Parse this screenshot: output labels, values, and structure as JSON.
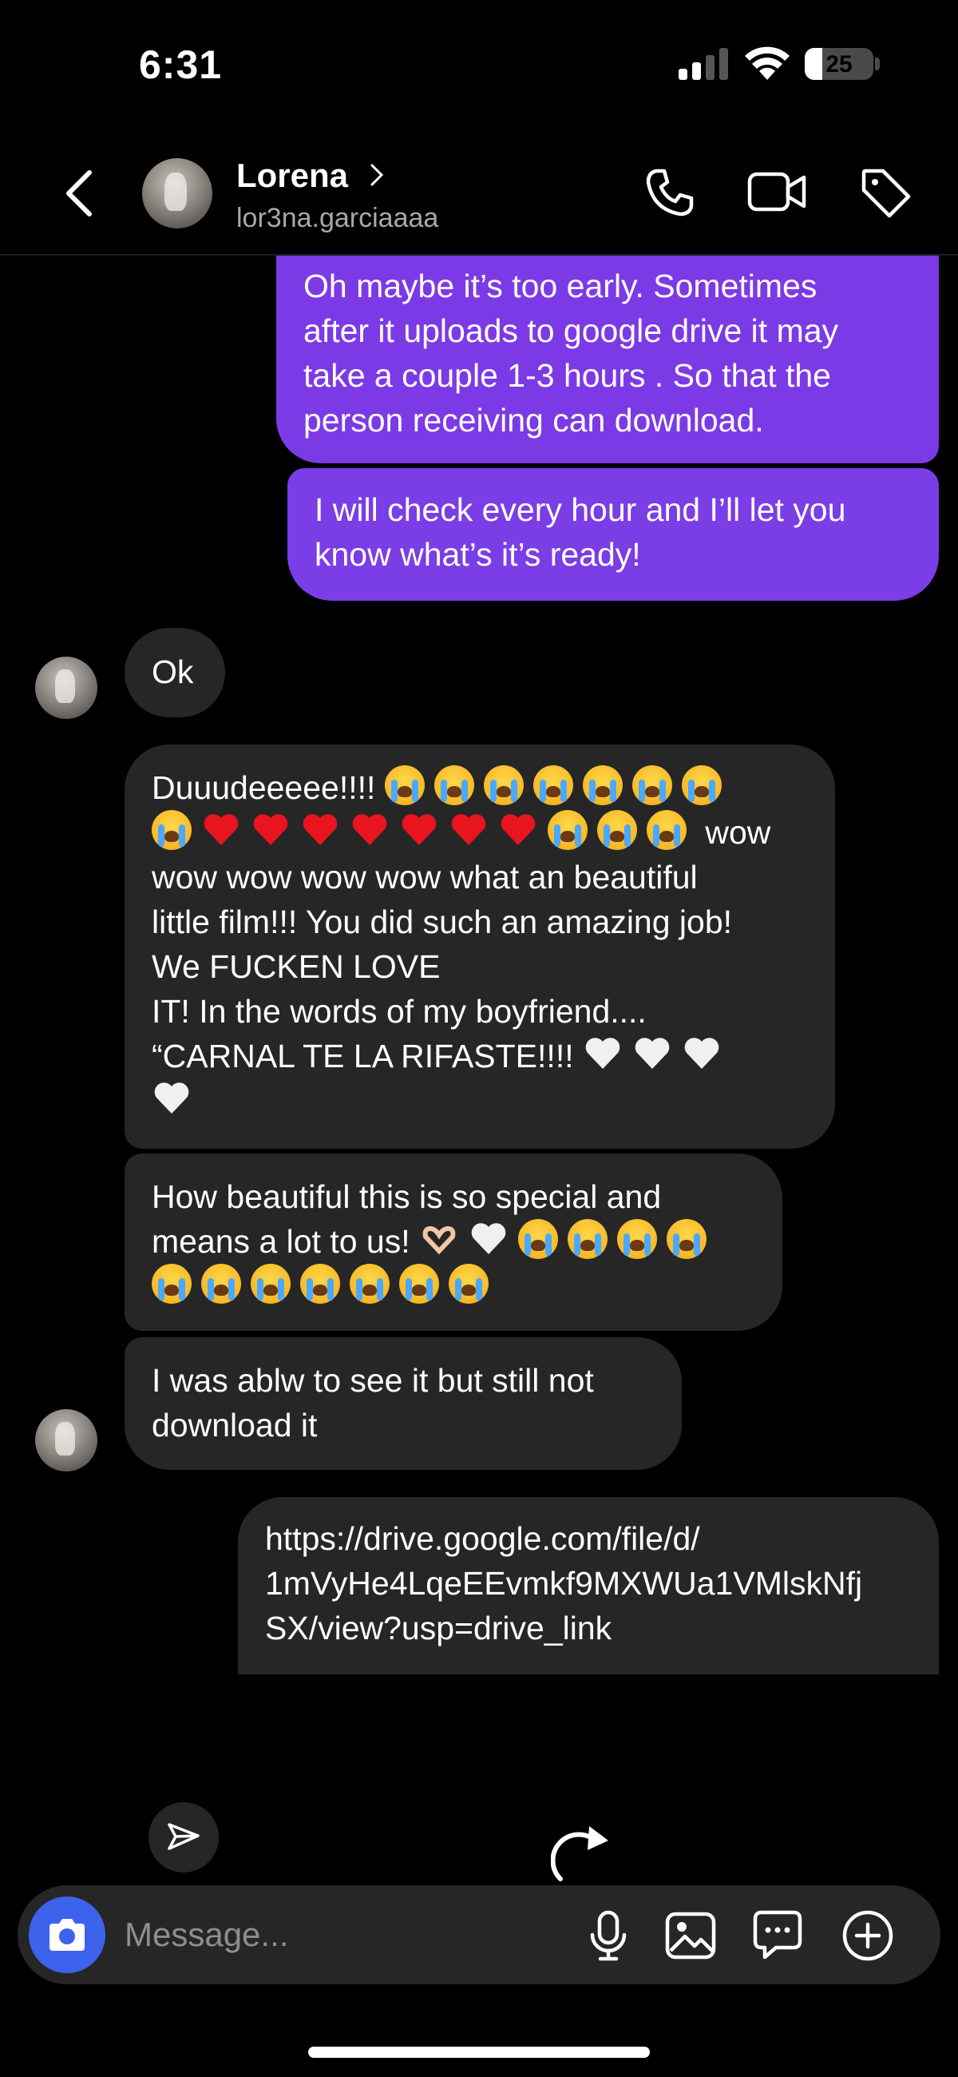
{
  "status_bar": {
    "time": "6:31",
    "battery_percent": "25",
    "icons": [
      "signal-icon",
      "wifi-icon",
      "battery-icon"
    ]
  },
  "header": {
    "contact_name": "Lorena",
    "contact_handle": "lor3na.garciaaaa",
    "icons": [
      "back-icon",
      "chevron-right-icon",
      "phone-icon",
      "video-camera-icon",
      "tag-icon"
    ]
  },
  "messages": [
    {
      "direction": "sent",
      "text": "Oh maybe it’s too early. Sometimes\nafter it uploads to google drive it may\ntake a couple 1-3 hours . So that the\nperson receiving can download."
    },
    {
      "direction": "sent",
      "text": "I will check every hour and I’ll let you\nknow what’s it’s ready!"
    },
    {
      "direction": "received",
      "text": "Ok"
    },
    {
      "direction": "received",
      "text_line_1": "Duuudeeeee!!!! ",
      "text_line_2": " wow",
      "text_rest": "wow wow wow wow what an beautiful\nlittle film!!! You did such an amazing job!\nWe FUCKEN LOVE\nIT! In the words of my boyfriend....\n“CARNAL TE LA RIFASTE!!!! "
    },
    {
      "direction": "received",
      "text_line_1": "How beautiful this is so special and",
      "text_line_2": "means a lot to us! "
    },
    {
      "direction": "received",
      "text": "I was ablw to see it but still not\ndownload it"
    },
    {
      "direction": "sent",
      "text": "https://drive.google.com/file/d/\n1mVyHe4LqeEEvmkf9MXWUa1VMlskNfj\nSX/view?usp=drive_link"
    }
  ],
  "composer": {
    "placeholder": "Message...",
    "icons": [
      "camera-icon",
      "microphone-icon",
      "gallery-icon",
      "sticker-icon",
      "plus-icon"
    ]
  },
  "colors": {
    "sent_bubble": "#7b38e8",
    "received_bubble": "#262626",
    "camera_button": "#3d63ec",
    "background": "#000000"
  }
}
